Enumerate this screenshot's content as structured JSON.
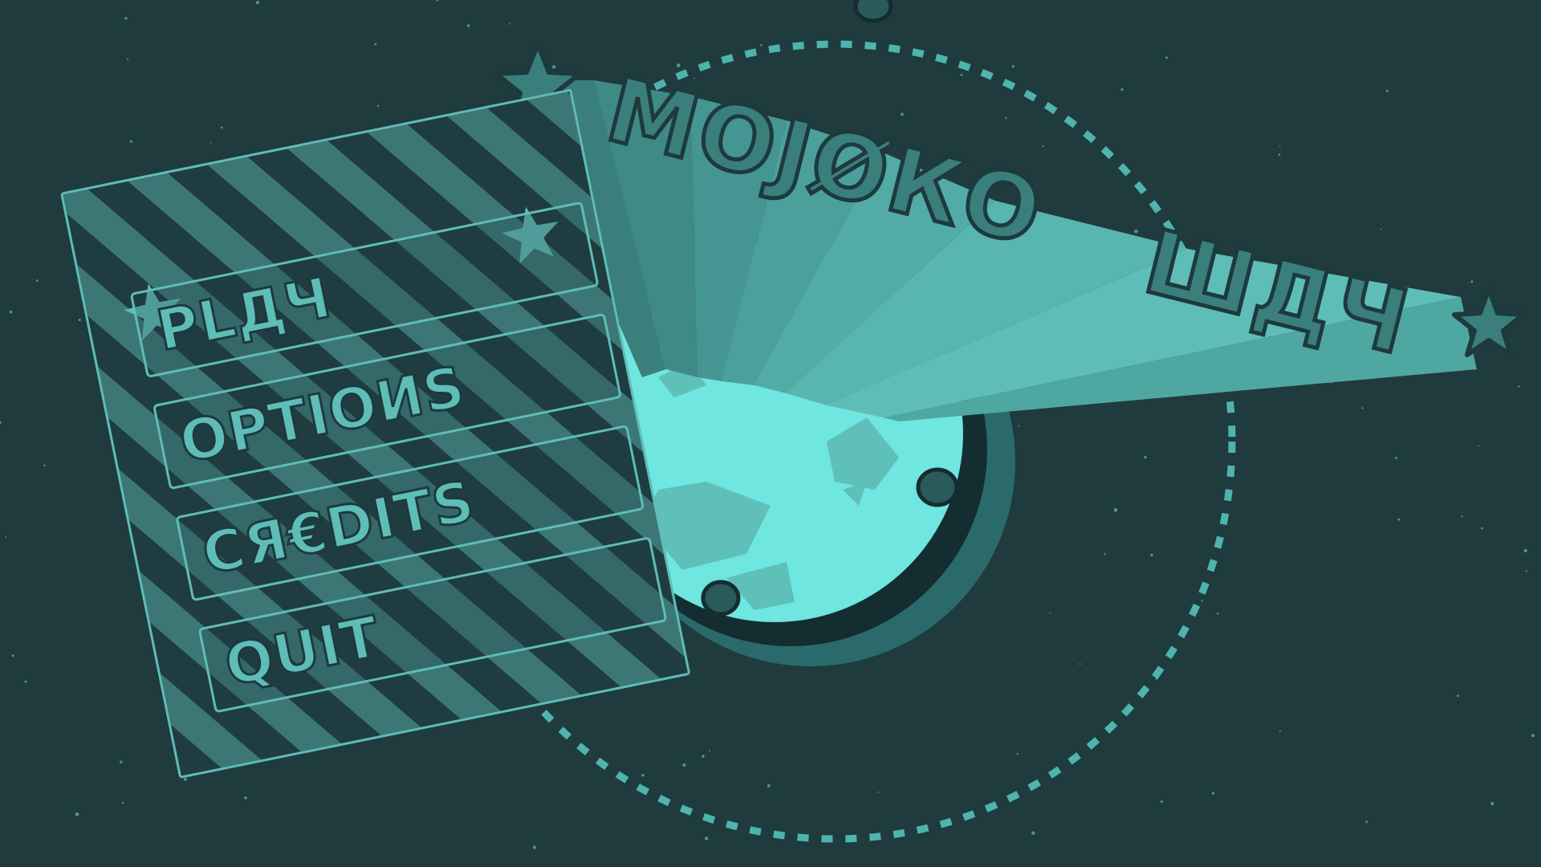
{
  "game": {
    "title_word_1": "МОЈØКО",
    "title_word_2": "ШДЧ"
  },
  "menu": {
    "items": [
      {
        "id": "play",
        "label": "PLДЧ"
      },
      {
        "id": "options",
        "label": "OPTIOИS"
      },
      {
        "id": "credits",
        "label": "CЯ€DITS"
      },
      {
        "id": "quit",
        "label": "QUIT"
      }
    ]
  },
  "colors": {
    "background": "#1f3b3e",
    "accent": "#5fbdb8",
    "planet": "#6fe6e0",
    "dark_outline": "#1d3a3d"
  },
  "icons": [
    "star-icon",
    "planet-icon",
    "asteroid-icon",
    "orbit-ring"
  ]
}
